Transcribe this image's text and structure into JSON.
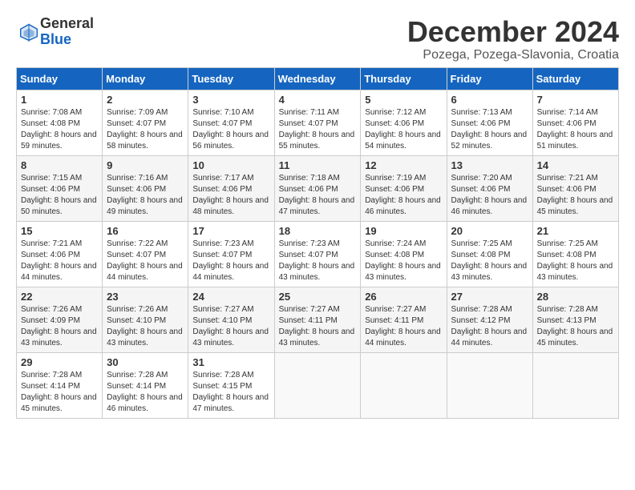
{
  "logo": {
    "general": "General",
    "blue": "Blue"
  },
  "header": {
    "month": "December 2024",
    "location": "Pozega, Pozega-Slavonia, Croatia"
  },
  "weekdays": [
    "Sunday",
    "Monday",
    "Tuesday",
    "Wednesday",
    "Thursday",
    "Friday",
    "Saturday"
  ],
  "weeks": [
    [
      {
        "day": "1",
        "sunrise": "7:08 AM",
        "sunset": "4:08 PM",
        "daylight": "8 hours and 59 minutes."
      },
      {
        "day": "2",
        "sunrise": "7:09 AM",
        "sunset": "4:07 PM",
        "daylight": "8 hours and 58 minutes."
      },
      {
        "day": "3",
        "sunrise": "7:10 AM",
        "sunset": "4:07 PM",
        "daylight": "8 hours and 56 minutes."
      },
      {
        "day": "4",
        "sunrise": "7:11 AM",
        "sunset": "4:07 PM",
        "daylight": "8 hours and 55 minutes."
      },
      {
        "day": "5",
        "sunrise": "7:12 AM",
        "sunset": "4:06 PM",
        "daylight": "8 hours and 54 minutes."
      },
      {
        "day": "6",
        "sunrise": "7:13 AM",
        "sunset": "4:06 PM",
        "daylight": "8 hours and 52 minutes."
      },
      {
        "day": "7",
        "sunrise": "7:14 AM",
        "sunset": "4:06 PM",
        "daylight": "8 hours and 51 minutes."
      }
    ],
    [
      {
        "day": "8",
        "sunrise": "7:15 AM",
        "sunset": "4:06 PM",
        "daylight": "8 hours and 50 minutes."
      },
      {
        "day": "9",
        "sunrise": "7:16 AM",
        "sunset": "4:06 PM",
        "daylight": "8 hours and 49 minutes."
      },
      {
        "day": "10",
        "sunrise": "7:17 AM",
        "sunset": "4:06 PM",
        "daylight": "8 hours and 48 minutes."
      },
      {
        "day": "11",
        "sunrise": "7:18 AM",
        "sunset": "4:06 PM",
        "daylight": "8 hours and 47 minutes."
      },
      {
        "day": "12",
        "sunrise": "7:19 AM",
        "sunset": "4:06 PM",
        "daylight": "8 hours and 46 minutes."
      },
      {
        "day": "13",
        "sunrise": "7:20 AM",
        "sunset": "4:06 PM",
        "daylight": "8 hours and 46 minutes."
      },
      {
        "day": "14",
        "sunrise": "7:21 AM",
        "sunset": "4:06 PM",
        "daylight": "8 hours and 45 minutes."
      }
    ],
    [
      {
        "day": "15",
        "sunrise": "7:21 AM",
        "sunset": "4:06 PM",
        "daylight": "8 hours and 44 minutes."
      },
      {
        "day": "16",
        "sunrise": "7:22 AM",
        "sunset": "4:07 PM",
        "daylight": "8 hours and 44 minutes."
      },
      {
        "day": "17",
        "sunrise": "7:23 AM",
        "sunset": "4:07 PM",
        "daylight": "8 hours and 44 minutes."
      },
      {
        "day": "18",
        "sunrise": "7:23 AM",
        "sunset": "4:07 PM",
        "daylight": "8 hours and 43 minutes."
      },
      {
        "day": "19",
        "sunrise": "7:24 AM",
        "sunset": "4:08 PM",
        "daylight": "8 hours and 43 minutes."
      },
      {
        "day": "20",
        "sunrise": "7:25 AM",
        "sunset": "4:08 PM",
        "daylight": "8 hours and 43 minutes."
      },
      {
        "day": "21",
        "sunrise": "7:25 AM",
        "sunset": "4:08 PM",
        "daylight": "8 hours and 43 minutes."
      }
    ],
    [
      {
        "day": "22",
        "sunrise": "7:26 AM",
        "sunset": "4:09 PM",
        "daylight": "8 hours and 43 minutes."
      },
      {
        "day": "23",
        "sunrise": "7:26 AM",
        "sunset": "4:10 PM",
        "daylight": "8 hours and 43 minutes."
      },
      {
        "day": "24",
        "sunrise": "7:27 AM",
        "sunset": "4:10 PM",
        "daylight": "8 hours and 43 minutes."
      },
      {
        "day": "25",
        "sunrise": "7:27 AM",
        "sunset": "4:11 PM",
        "daylight": "8 hours and 43 minutes."
      },
      {
        "day": "26",
        "sunrise": "7:27 AM",
        "sunset": "4:11 PM",
        "daylight": "8 hours and 44 minutes."
      },
      {
        "day": "27",
        "sunrise": "7:28 AM",
        "sunset": "4:12 PM",
        "daylight": "8 hours and 44 minutes."
      },
      {
        "day": "28",
        "sunrise": "7:28 AM",
        "sunset": "4:13 PM",
        "daylight": "8 hours and 45 minutes."
      }
    ],
    [
      {
        "day": "29",
        "sunrise": "7:28 AM",
        "sunset": "4:14 PM",
        "daylight": "8 hours and 45 minutes."
      },
      {
        "day": "30",
        "sunrise": "7:28 AM",
        "sunset": "4:14 PM",
        "daylight": "8 hours and 46 minutes."
      },
      {
        "day": "31",
        "sunrise": "7:28 AM",
        "sunset": "4:15 PM",
        "daylight": "8 hours and 47 minutes."
      },
      null,
      null,
      null,
      null
    ]
  ],
  "labels": {
    "sunrise": "Sunrise:",
    "sunset": "Sunset:",
    "daylight": "Daylight:"
  }
}
